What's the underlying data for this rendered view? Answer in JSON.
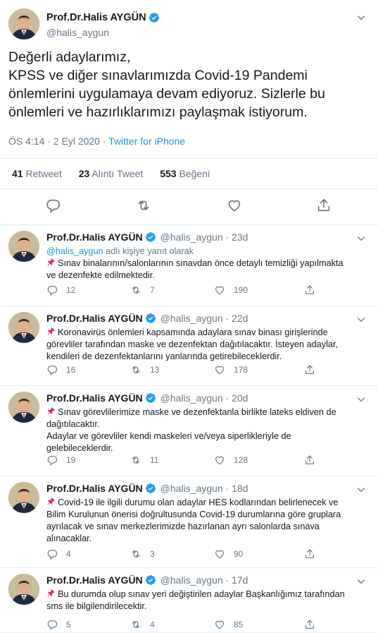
{
  "colors": {
    "accent": "#1b95e0",
    "verified": "#1da1f2",
    "muted": "#657786",
    "text": "#14171a",
    "divider": "#e6ecf0"
  },
  "main_tweet": {
    "name": "Prof.Dr.Halis AYGÜN",
    "handle": "@halis_aygun",
    "text_lines": [
      "Değerli adaylarımız,",
      "KPSS ve diğer sınavlarımızda Covid-19 Pandemi",
      "önlemlerini uygulamaya devam ediyoruz. Sizlerle bu",
      "önlemleri ve hazırlıklarımızı paylaşmak istiyorum."
    ],
    "timestamp": "ÖS 4:14 · 2 Eyl 2020 · ",
    "source": "Twitter for iPhone",
    "stats": {
      "retweets_count": "41",
      "retweets_label": "Retweet",
      "quotes_count": "23",
      "quotes_label": "Alıntı Tweet",
      "likes_count": "553",
      "likes_label": "Beğeni"
    },
    "icons": [
      "reply-icon",
      "retweet-icon",
      "like-icon",
      "share-icon"
    ]
  },
  "replies": [
    {
      "name": "Prof.Dr.Halis AYGÜN",
      "handle": "@halis_aygun · 23d",
      "reply_to_mention": "@halis_aygun",
      "reply_to_suffix": " adlı kişiye yanıt olarak",
      "lines": [
        "Sınav binalarının/salonlarının sınavdan önce detaylı temizliği yapılmakta",
        "ve dezenfekte edilmektedir."
      ],
      "pin_first": true,
      "replies": "12",
      "retweets": "7",
      "likes": "190"
    },
    {
      "name": "Prof.Dr.Halis AYGÜN",
      "handle": "@halis_aygun · 22d",
      "lines": [
        "Koronavirüs önlemleri kapsamında adaylara sınav binası girişlerinde",
        "görevliler tarafından maske ve dezenfektan dağıtılacaktır. İsteyen adaylar,",
        "kendileri de dezenfektanlarını yanlarında getirebileceklerdir."
      ],
      "pin_first": true,
      "replies": "16",
      "retweets": "13",
      "likes": "178"
    },
    {
      "name": "Prof.Dr.Halis AYGÜN",
      "handle": "@halis_aygun · 20d",
      "lines": [
        "Sınav görevlilerimize maske ve dezenfektanla birlikte lateks eldiven de",
        "dağıtılacaktır.",
        "Adaylar ve görevliler kendi maskeleri ve/veya siperlikleriyle de",
        "gelebileceklerdir."
      ],
      "pin_first": true,
      "replies": "19",
      "retweets": "11",
      "likes": "128"
    },
    {
      "name": "Prof.Dr.Halis AYGÜN",
      "handle": "@halis_aygun · 18d",
      "lines": [
        "Covid-19 ile ilgili durumu olan adaylar HES kodlarından belirlenecek ve",
        "Bilim Kurulunun önerisi doğrultusunda Covid-19 durumlarına göre gruplara",
        "ayrılacak ve sınav merkezlerimizde hazırlanan ayrı salonlarda sınava",
        "alınacaklar."
      ],
      "pin_first": true,
      "replies": "4",
      "retweets": "3",
      "likes": "90"
    },
    {
      "name": "Prof.Dr.Halis AYGÜN",
      "handle": "@halis_aygun · 17d",
      "lines": [
        "Bu durumda olup sınav yeri değiştirilen adaylar Başkanlığımız tarafından",
        "sms ile bilgilendirilecektir."
      ],
      "pin_first": true,
      "replies": "5",
      "retweets": "4",
      "likes": "85"
    }
  ]
}
